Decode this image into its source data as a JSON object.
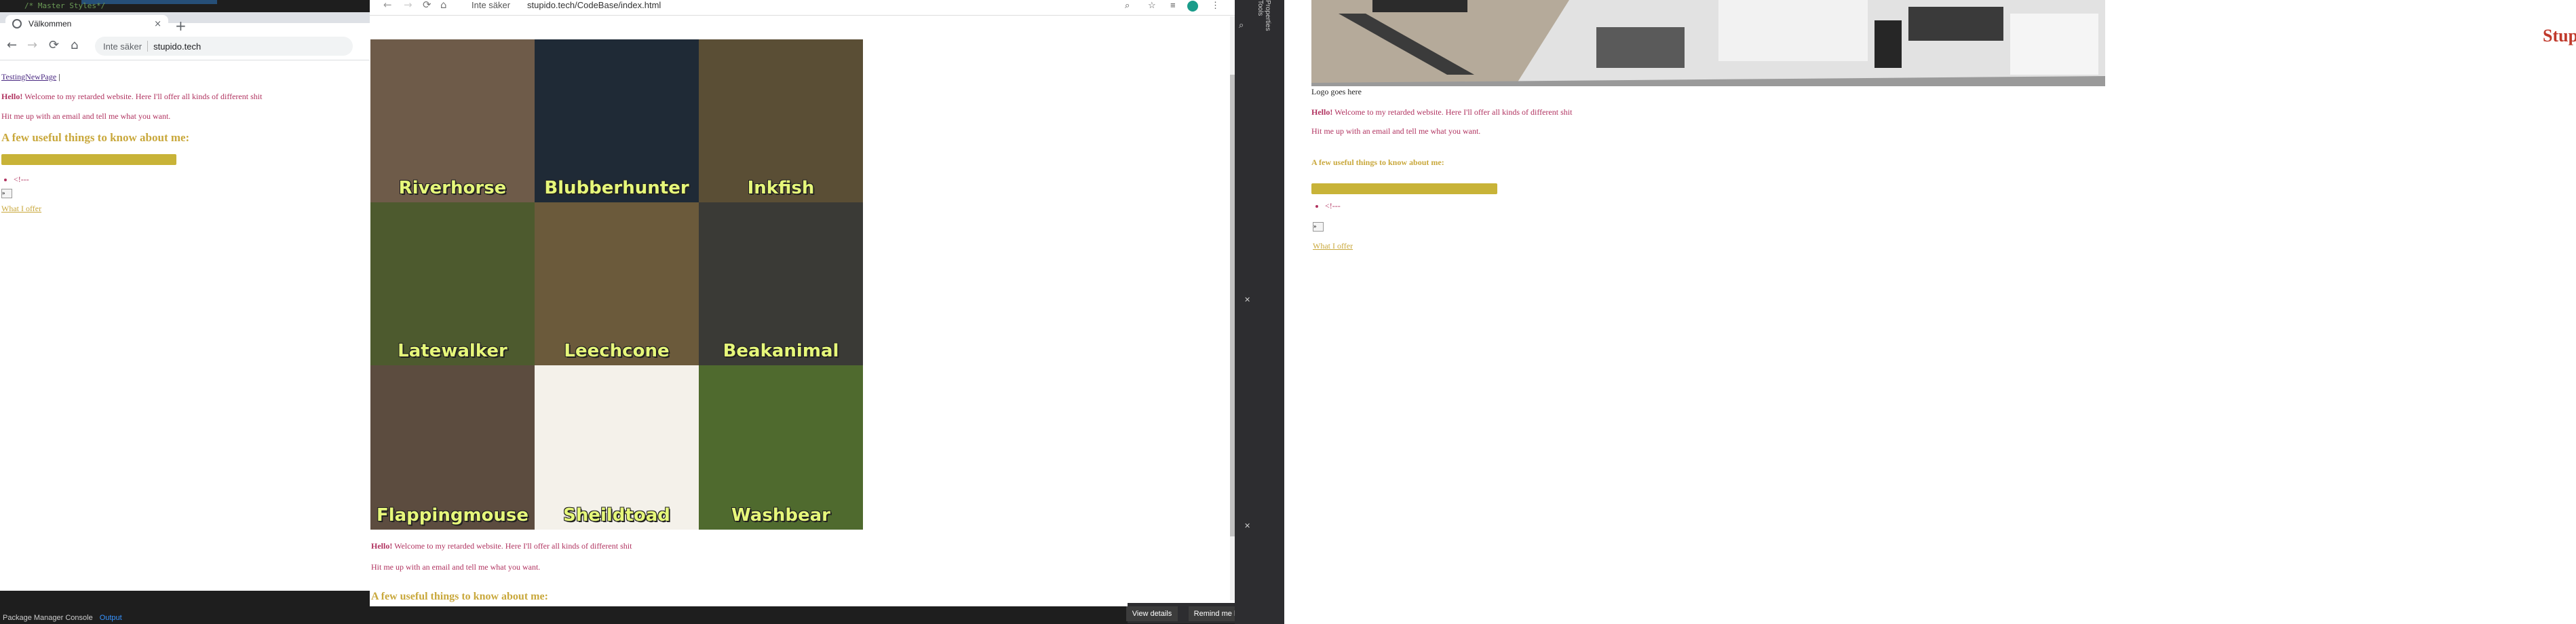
{
  "left_browser": {
    "code_comment": "/* Master Styles*/",
    "tab_title": "Välkommen",
    "tab_close": "×",
    "new_tab": "+",
    "back": "←",
    "forward": "→",
    "reload": "⟳",
    "home": "⌂",
    "security": "Inte säker",
    "url": "stupido.tech",
    "nav_link": "TestingNewPage",
    "nav_pipe": "|",
    "hello": "Hello!",
    "welcome": " Welcome to my retarded website. Here I'll offer all kinds of different shit",
    "contact": "Hit me up with an email and tell me what you want.",
    "heading": "A few useful things to know about me:",
    "list_item": "<!---",
    "btn": "»",
    "offer_link": "What I offer"
  },
  "bottom_panel": {
    "tab1": "Package Manager Console",
    "tab2": "Output"
  },
  "mid_browser": {
    "security": "Inte säker",
    "url": "stupido.tech/CodeBase/index.html",
    "animals": [
      {
        "label": "Riverhorse",
        "bg": "#6e5b49"
      },
      {
        "label": "Blubberhunter",
        "bg": "#1f2a36"
      },
      {
        "label": "Inkfish",
        "bg": "#5a4e35"
      },
      {
        "label": "Latewalker",
        "bg": "#4d5a2e"
      },
      {
        "label": "Leechcone",
        "bg": "#6b5a3b"
      },
      {
        "label": "Beakanimal",
        "bg": "#3a3a36"
      },
      {
        "label": "Flappingmouse",
        "bg": "#5c4c3f"
      },
      {
        "label": "Sheildtoad",
        "bg": "#f4f1ea"
      },
      {
        "label": "Washbear",
        "bg": "#4f6a2e"
      }
    ],
    "hello": "Hello!",
    "welcome": " Welcome to my retarded website. Here I'll offer all kinds of different shit",
    "contact": "Hit me up with an email and tell me what you want.",
    "heading": "A few useful things to know about me:",
    "close": "✕"
  },
  "notification": {
    "view_details": "View details",
    "remind_later": "Remind me later"
  },
  "vs_strip": {
    "tools": "Properties Tools",
    "pin1": "✕",
    "pin2": "✕"
  },
  "right_page": {
    "brand": "StupidO",
    "logo_text": "Logo goes here",
    "hello": "Hello!",
    "welcome": " Welcome to my retarded website. Here I'll offer all kinds of different shit",
    "contact": "Hit me up with an email and tell me what you want.",
    "heading": "A few useful things to know about me:",
    "list_item": "<!---",
    "btn": "»",
    "offer_link": "What I offer"
  }
}
